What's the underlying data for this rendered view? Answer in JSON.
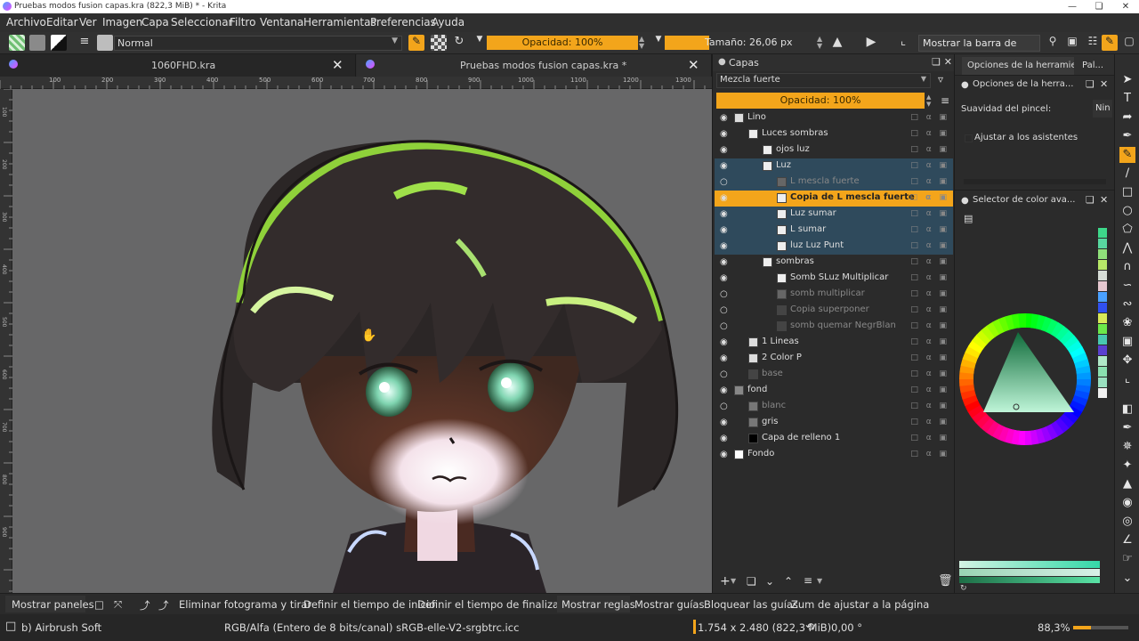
{
  "window": {
    "title": "Pruebas modos fusion capas.kra (822,3 MiB)  * - Krita"
  },
  "menu": [
    "Archivo",
    "Editar",
    "Ver",
    "Imagen",
    "Capa",
    "Seleccionar",
    "Filtro",
    "Ventana",
    "Herramientas",
    "Preferencias",
    "Ayuda"
  ],
  "toolbar": {
    "blend_mode": "Normal",
    "opacity": "Opacidad: 100%",
    "size": "Tamaño: 26,06 px",
    "show_status": "Mostrar la barra de estado"
  },
  "tabs": [
    {
      "label": "1060FHD.kra"
    },
    {
      "label": "Pruebas modos fusion capas.kra *"
    }
  ],
  "ruler": [
    "100",
    "200",
    "300",
    "400",
    "500",
    "600",
    "700",
    "800",
    "900",
    "1000",
    "1100",
    "1200",
    "1300"
  ],
  "vruler": [
    "100",
    "200",
    "300",
    "400",
    "500",
    "600",
    "700",
    "800",
    "900"
  ],
  "layers_panel": {
    "title": "Capas",
    "blend_mode": "Mezcla fuerte",
    "opacity": "Opacidad:  100%",
    "rows": [
      {
        "name": "Lino",
        "indent": 0,
        "sel": false,
        "cur": false,
        "thumb": "#ddd"
      },
      {
        "name": "Luces sombras",
        "indent": 1,
        "sel": false,
        "cur": false,
        "thumb": "#eee"
      },
      {
        "name": "ojos luz",
        "indent": 2,
        "sel": false,
        "cur": false,
        "thumb": "#eee"
      },
      {
        "name": "Luz",
        "indent": 2,
        "sel": true,
        "cur": false,
        "thumb": "#eee"
      },
      {
        "name": "L mescla fuerte",
        "indent": 3,
        "sel": true,
        "cur": false,
        "thumb": "#666",
        "dim": true
      },
      {
        "name": "Copia de L mescla fuerte",
        "indent": 3,
        "sel": false,
        "cur": true,
        "thumb": "#eee"
      },
      {
        "name": "Luz sumar",
        "indent": 3,
        "sel": true,
        "cur": false,
        "thumb": "#eee"
      },
      {
        "name": "L sumar",
        "indent": 3,
        "sel": true,
        "cur": false,
        "thumb": "#eee"
      },
      {
        "name": "luz Luz Punt",
        "indent": 3,
        "sel": true,
        "cur": false,
        "thumb": "#eee"
      },
      {
        "name": "sombras",
        "indent": 2,
        "sel": false,
        "cur": false,
        "thumb": "#eee"
      },
      {
        "name": "Somb SLuz Multiplicar",
        "indent": 3,
        "sel": false,
        "cur": false,
        "thumb": "#eee"
      },
      {
        "name": "somb multiplicar",
        "indent": 3,
        "sel": false,
        "cur": false,
        "thumb": "#666",
        "dim": true
      },
      {
        "name": "Copia superponer",
        "indent": 3,
        "sel": false,
        "cur": false,
        "thumb": "#444",
        "dim": true
      },
      {
        "name": "somb quemar NegrBlan",
        "indent": 3,
        "sel": false,
        "cur": false,
        "thumb": "#444",
        "dim": true
      },
      {
        "name": "1 Lineas",
        "indent": 1,
        "sel": false,
        "cur": false,
        "thumb": "#ddd"
      },
      {
        "name": "2 Color P",
        "indent": 1,
        "sel": false,
        "cur": false,
        "thumb": "#ddd"
      },
      {
        "name": "base",
        "indent": 1,
        "sel": false,
        "cur": false,
        "thumb": "#444",
        "dim": true
      },
      {
        "name": "fond",
        "indent": 0,
        "sel": false,
        "cur": false,
        "thumb": "#888"
      },
      {
        "name": "blanc",
        "indent": 1,
        "sel": false,
        "cur": false,
        "thumb": "#777",
        "dim": true
      },
      {
        "name": "gris",
        "indent": 1,
        "sel": false,
        "cur": false,
        "thumb": "#777"
      },
      {
        "name": "Capa de relleno 1",
        "indent": 1,
        "sel": false,
        "cur": false,
        "thumb": "#000"
      },
      {
        "name": "Fondo",
        "indent": 0,
        "sel": false,
        "cur": false,
        "thumb": "#fff"
      }
    ]
  },
  "tool_options": {
    "tab1": "Opciones de la herramie...",
    "tab2": "Pal...",
    "header": "Opciones de la herra...",
    "smoothing_label": "Suavidad del pincel:",
    "smoothing_value": "Nin",
    "assist_label": "Ajustar a los asistentes",
    "color_selector": "Selector de color ava..."
  },
  "status1": [
    "Mostrar paneles",
    "Eliminar fotograma y tirar",
    "Definir el tiempo de inicio",
    "Definir el tiempo de finalización",
    "Mostrar reglas",
    "Mostrar guías",
    "Bloquear las guías",
    "Zum de ajustar a la página"
  ],
  "status2": {
    "brush": "b) Airbrush Soft",
    "colorspace": "RGB/Alfa (Entero de 8 bits/canal)  sRGB-elle-V2-srgbtrc.icc",
    "dims": "1.754 x 2.480 (822,3 MiB)",
    "rotation": "0,00 °",
    "zoom": "88,3%"
  },
  "colors": {
    "accent": "#f3a51b",
    "selection": "#2f4a5c"
  }
}
